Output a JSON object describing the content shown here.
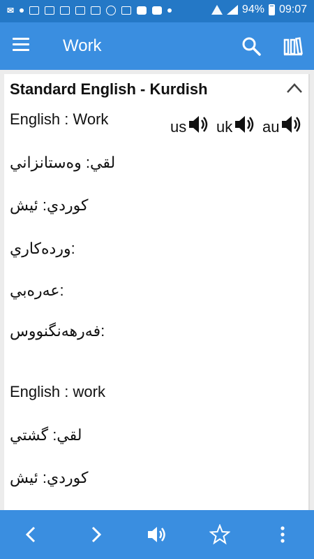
{
  "status_bar": {
    "battery": "94%",
    "time": "09:07",
    "icons": [
      "notification-icons"
    ]
  },
  "app_bar": {
    "title": "Work",
    "icons": [
      "menu-icon",
      "search-icon",
      "library-icon"
    ]
  },
  "card": {
    "title": "Standard English - Kurdish",
    "entries": [
      {
        "english": "English : Work",
        "pronunciations": [
          "us",
          "uk",
          "au"
        ],
        "lqi": "لقي: وەستانزاني",
        "kurdi": "كوردي: ئيش",
        "wrdakari": "وردەكاري:",
        "arabi": "عەرەبي:",
        "farhang": "فەرهەنگنووس:"
      },
      {
        "english": "English : work",
        "lqi": "لقي: گشتي",
        "kurdi": "كوردي: ئيش"
      }
    ]
  },
  "bottom_bar": {
    "icons": [
      "back-icon",
      "forward-icon",
      "speaker-icon",
      "star-icon",
      "more-icon"
    ]
  },
  "colors": {
    "status_bar": "#2478c6",
    "app_bar": "#3a8ee0",
    "card_bg": "#ffffff",
    "page_bg": "#ececec"
  }
}
